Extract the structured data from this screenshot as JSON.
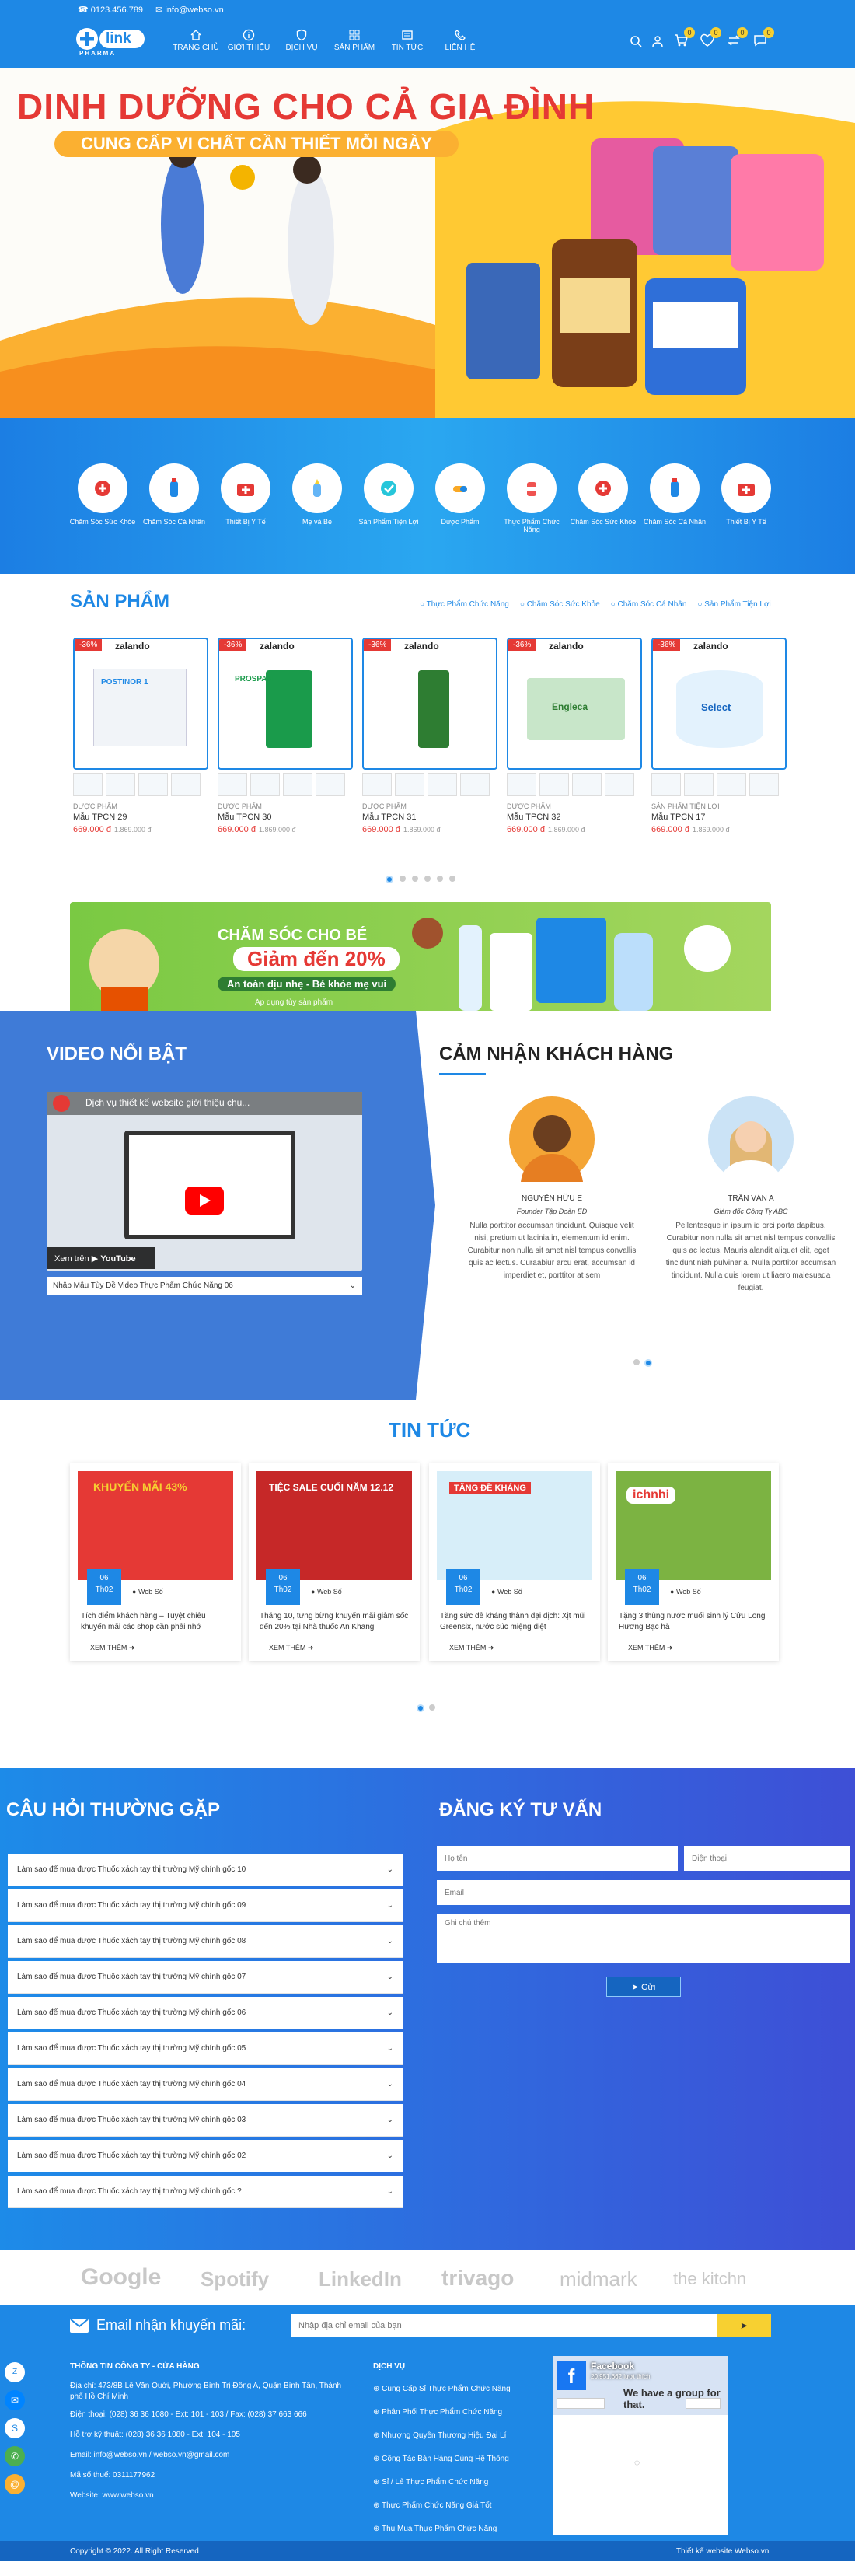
{
  "topbar": {
    "phone": "0123.456.789",
    "email": "info@webso.vn"
  },
  "logo": {
    "text": "link",
    "sub": "PHARMA"
  },
  "nav": [
    {
      "label": "TRANG CHỦ",
      "icon": "home-icon"
    },
    {
      "label": "GIỚI THIỆU",
      "icon": "info-icon"
    },
    {
      "label": "DỊCH VỤ",
      "icon": "shield-icon"
    },
    {
      "label": "SẢN PHẨM",
      "icon": "grid-icon"
    },
    {
      "label": "TIN TỨC",
      "icon": "news-icon"
    },
    {
      "label": "LIÊN HỆ",
      "icon": "phone-icon"
    }
  ],
  "header_badges": {
    "cart": "0",
    "wishlist": "0",
    "compare": "0",
    "chat": "0"
  },
  "hero": {
    "title": "DINH DƯỠNG CHO CẢ GIA ĐÌNH",
    "subtitle": "CUNG CẤP VI CHẤT CẦN THIẾT MỖI NGÀY"
  },
  "categories": [
    {
      "label": "Chăm Sóc Sức Khỏe"
    },
    {
      "label": "Chăm Sóc Cá Nhân"
    },
    {
      "label": "Thiết Bị Y Tế"
    },
    {
      "label": "Mẹ và Bé"
    },
    {
      "label": "Sản Phẩm Tiện Lợi"
    },
    {
      "label": "Dược Phẩm"
    },
    {
      "label": "Thực Phẩm Chức Năng"
    },
    {
      "label": "Chăm Sóc Sức Khỏe"
    },
    {
      "label": "Chăm Sóc Cá Nhân"
    },
    {
      "label": "Thiết Bị Y Tế"
    }
  ],
  "products": {
    "title": "SẢN PHẨM",
    "tabs": [
      "Thực Phẩm Chức Năng",
      "Chăm Sóc Sức Khỏe",
      "Chăm Sóc Cá Nhân",
      "Sản Phẩm Tiện Lợi"
    ],
    "items": [
      {
        "type": "DƯỢC PHẨM",
        "name": "Mẫu TPCN 29",
        "price": "669.000 đ",
        "old": "1.869.000 đ",
        "discount": "-36%",
        "brand": "zalando",
        "box": "POSTINOR 1"
      },
      {
        "type": "DƯỢC PHẨM",
        "name": "Mẫu TPCN 30",
        "price": "669.000 đ",
        "old": "1.869.000 đ",
        "discount": "-36%",
        "brand": "zalando",
        "box": "PROSPAN"
      },
      {
        "type": "DƯỢC PHẨM",
        "name": "Mẫu TPCN 31",
        "price": "669.000 đ",
        "old": "1.869.000 đ",
        "discount": "-36%",
        "brand": "zalando",
        "box": ""
      },
      {
        "type": "DƯỢC PHẨM",
        "name": "Mẫu TPCN 32",
        "price": "669.000 đ",
        "old": "1.869.000 đ",
        "discount": "-36%",
        "brand": "zalando",
        "box": "Engleca"
      },
      {
        "type": "SẢN PHẨM TIỆN LỢI",
        "name": "Mẫu TPCN 17",
        "price": "669.000 đ",
        "old": "1.869.000 đ",
        "discount": "-36%",
        "brand": "zalando",
        "box": "Select"
      }
    ]
  },
  "promo": {
    "title": "CHĂM SÓC CHO BÉ",
    "discount": "Giảm đến 20%",
    "tagline": "An toàn dịu nhẹ - Bé khỏe mẹ vui",
    "note": "Áp dụng tùy sản phẩm"
  },
  "video": {
    "title": "VIDEO NỔI BẬT",
    "player_title": "Dịch vụ thiết kế website giới thiệu chu...",
    "watch_on": "Xem trên",
    "youtube": "YouTube",
    "select": "Nhập Mẫu Tùy Đề Video Thực Phẩm Chức Năng 06"
  },
  "testimonials": {
    "title": "CẢM NHẬN KHÁCH HÀNG",
    "items": [
      {
        "name": "NGUYỄN HỮU E",
        "role": "Founder Tập Đoàn ED",
        "text": "Nulla porttitor accumsan tincidunt. Quisque velit nisi, pretium ut lacinia in, elementum id enim. Curabitur non nulla sit amet nisl tempus convallis quis ac lectus. Curaabiur arcu erat, accumsan id imperdiet et, porttitor at sem"
      },
      {
        "name": "TRẦN VĂN A",
        "role": "Giám đốc Công Ty ABC",
        "text": "Pellentesque in ipsum id orci porta dapibus. Curabitur non nulla sit amet nisl tempus convallis quis ac lectus. Mauris alandit aliquet elit, eget tincidunt niah pulvinar a. Nulla porttitor accumsan tincidunt. Nulla quis lorem ut liaero malesuada feugiat."
      }
    ]
  },
  "news": {
    "title": "TIN TỨC",
    "items": [
      {
        "day": "06",
        "month": "Th02",
        "author": "Web Số",
        "title": "Tích điểm khách hàng – Tuyệt chiêu khuyến mãi các shop cần phải nhớ",
        "more": "XEM THÊM",
        "banner": "KHUYẾN MÃI 43%"
      },
      {
        "day": "06",
        "month": "Th02",
        "author": "Web Số",
        "title": "Tháng 10, tưng bừng khuyến mãi giảm sốc đến 20% tại Nhà thuốc An Khang",
        "more": "XEM THÊM",
        "banner": "TIỆC SALE CUỐI NĂM 12.12"
      },
      {
        "day": "06",
        "month": "Th02",
        "author": "Web Số",
        "title": "Tăng sức đề kháng thảnh đại dịch: Xịt mũi Greensix, nước súc miệng diệt",
        "more": "XEM THÊM",
        "banner": "TĂNG ĐỀ KHÁNG"
      },
      {
        "day": "06",
        "month": "Th02",
        "author": "Web Số",
        "title": "Tặng 3 thùng nước muối sinh lý Cửu Long Hương Bạc hà",
        "more": "XEM THÊM",
        "banner": "ichnhi"
      }
    ]
  },
  "faq": {
    "title": "CÂU HỎI THƯỜNG GẶP",
    "items": [
      "Làm sao để mua được Thuốc xách tay thị trường Mỹ chính gốc 10",
      "Làm sao để mua được Thuốc xách tay thị trường Mỹ chính gốc 09",
      "Làm sao để mua được Thuốc xách tay thị trường Mỹ chính gốc 08",
      "Làm sao để mua được Thuốc xách tay thị trường Mỹ chính gốc 07",
      "Làm sao để mua được Thuốc xách tay thị trường Mỹ chính gốc 06",
      "Làm sao để mua được Thuốc xách tay thị trường Mỹ chính gốc 05",
      "Làm sao để mua được Thuốc xách tay thị trường Mỹ chính gốc 04",
      "Làm sao để mua được Thuốc xách tay thị trường Mỹ chính gốc 03",
      "Làm sao để mua được Thuốc xách tay thị trường Mỹ chính gốc 02",
      "Làm sao để mua được Thuốc xách tay thị trường Mỹ chính gốc ?"
    ]
  },
  "consult": {
    "title": "ĐĂNG KÝ TƯ VẤN",
    "name_ph": "Họ tên",
    "phone_ph": "Điện thoại",
    "email_ph": "Email",
    "note_ph": "Ghi chú thêm",
    "submit": "Gửi"
  },
  "partners": [
    "Google",
    "Spotify",
    "LinkedIn",
    "trivago",
    "midmark",
    "the kitchn"
  ],
  "newsletter": {
    "label": "Email nhận khuyến mãi:",
    "placeholder": "Nhập địa chỉ email của bạn"
  },
  "footer": {
    "company_title": "THÔNG TIN CÔNG TY - CỬA HÀNG",
    "address": "Địa chỉ: 473/8B Lê Văn Quới, Phường Bình Trị Đông A, Quận Bình Tân, Thành phố Hồ Chí Minh",
    "phone": "Điện thoại: (028) 36 36 1080 - Ext: 101 - 103 / Fax: (028) 37 663 666",
    "support": "Hỗ trợ kỹ thuật: (028) 36 36 1080 - Ext: 104 - 105",
    "email": "Email: info@webso.vn / webso.vn@gmail.com",
    "tax": "Mã số thuế: 0311177962",
    "website": "Website: www.webso.vn",
    "services_title": "DỊCH VỤ",
    "services": [
      "Cung Cấp Sỉ Thực Phẩm Chức Năng",
      "Phân Phối Thực Phẩm Chức Năng",
      "Nhượng Quyền Thương Hiệu Đại Lí",
      "Cộng Tác Bán Hàng Cùng Hệ Thống",
      "Sỉ / Lẻ Thực Phẩm Chức Năng",
      "Thực Phẩm Chức Năng Giá Tốt",
      "Thu Mua Thực Phẩm Chức Năng"
    ],
    "fb_title": "Facebook",
    "fb_followers": "20,951,662 lượt thích",
    "fb_like": "Thích Trang",
    "fb_share": "Chia sẻ",
    "fb_banner": "We have a group for that.",
    "copyright": "Copyright © 2022. All Right Reserved",
    "credit": "Thiết kế website Webso.vn"
  },
  "colors": {
    "primary": "#1e88e5",
    "accent": "#f7d031",
    "sale": "#e53935"
  }
}
